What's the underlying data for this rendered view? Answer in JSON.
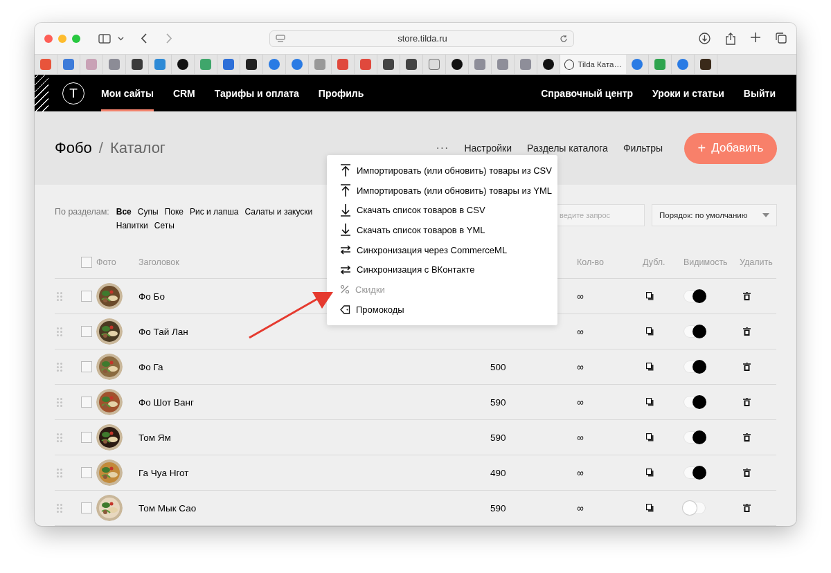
{
  "browser": {
    "address": "store.tilda.ru",
    "active_tab": {
      "title": "Tilda Ката…"
    }
  },
  "site_header": {
    "logo": "T",
    "nav": [
      {
        "label": "Мои сайты",
        "selected": true
      },
      {
        "label": "CRM",
        "selected": false
      },
      {
        "label": "Тарифы и оплата",
        "selected": false
      },
      {
        "label": "Профиль",
        "selected": false
      }
    ],
    "right_links": [
      "Справочный центр",
      "Уроки и статьи",
      "Выйти"
    ]
  },
  "catalog_bar": {
    "project": "Фобо",
    "separator": "/",
    "page": "Каталог",
    "more": "···",
    "links": [
      "Настройки",
      "Разделы каталога",
      "Фильтры"
    ],
    "add_button": {
      "icon": "+",
      "label": "Добавить"
    }
  },
  "filters": {
    "label": "По разделам:",
    "sections": [
      {
        "label": "Все",
        "selected": true
      },
      {
        "label": "Супы",
        "selected": false
      },
      {
        "label": "Поке",
        "selected": false
      },
      {
        "label": "Рис и лапша",
        "selected": false
      },
      {
        "label": "Салаты и закуски",
        "selected": false
      },
      {
        "label": "Напитки",
        "selected": false
      },
      {
        "label": "Сеты",
        "selected": false
      }
    ],
    "search": {
      "placeholder": "ведите запрос"
    },
    "sort": {
      "value": "Порядок: по умолчанию"
    }
  },
  "table": {
    "select_all": {
      "checked": false
    },
    "columns": [
      "Фото",
      "Заголовок",
      "Кол-во",
      "Дубл.",
      "Видимость",
      "Удалить"
    ],
    "rows": [
      {
        "checked": false,
        "title": "Фо Бо",
        "quantity": "∞",
        "visible": true
      },
      {
        "checked": false,
        "title": "Фо Тай Лан",
        "quantity": "∞",
        "visible": true
      },
      {
        "checked": false,
        "title": "Фо Га",
        "price": "500",
        "quantity": "∞",
        "visible": true
      },
      {
        "checked": false,
        "title": "Фо Шот Ванг",
        "price": "590",
        "quantity": "∞",
        "visible": true
      },
      {
        "checked": false,
        "title": "Том Ям",
        "price": "590",
        "quantity": "∞",
        "visible": true
      },
      {
        "checked": false,
        "title": "Га Чуа Нгот",
        "price": "490",
        "quantity": "∞",
        "visible": true
      },
      {
        "checked": false,
        "title": "Том Мык Сао",
        "price": "590",
        "quantity": "∞",
        "visible": false
      }
    ]
  },
  "menu": {
    "items": [
      {
        "kind": "upload",
        "label": "Импортировать (или обновить) товары из CSV",
        "disabled": false
      },
      {
        "kind": "upload",
        "label": "Импортировать (или обновить) товары из YML",
        "disabled": false
      },
      {
        "kind": "download",
        "label": "Скачать список товаров в CSV",
        "disabled": false
      },
      {
        "kind": "download",
        "label": "Скачать список товаров в YML",
        "disabled": false
      },
      {
        "kind": "sync",
        "label": "Синхронизация через CommerceML",
        "disabled": false
      },
      {
        "kind": "sync",
        "label": "Синхронизация с ВКонтакте",
        "disabled": false
      },
      {
        "kind": "percent",
        "label": "Скидки",
        "disabled": true
      },
      {
        "kind": "tag",
        "label": "Промокоды",
        "disabled": false
      }
    ]
  }
}
